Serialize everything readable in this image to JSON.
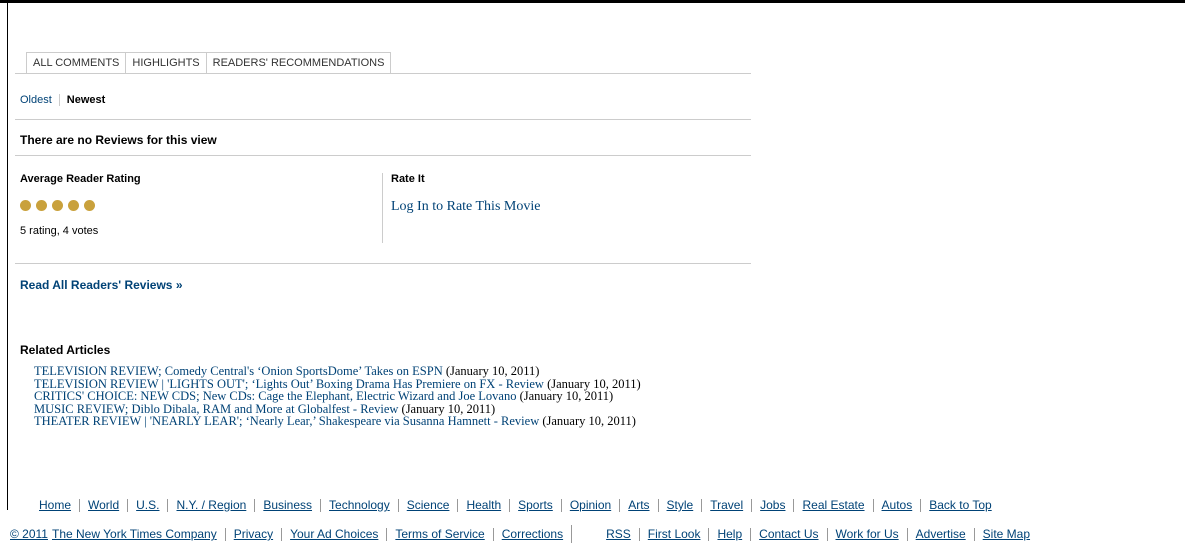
{
  "tabs": [
    "ALL COMMENTS",
    "HIGHLIGHTS",
    "READERS' RECOMMENDATIONS"
  ],
  "sort": {
    "oldest": "Oldest",
    "newest": "Newest"
  },
  "no_reviews": "There are no Reviews for this view",
  "rating": {
    "avg_title": "Average Reader Rating",
    "stars": 5,
    "summary": "5 rating, 4 votes",
    "color": "#c9a13c"
  },
  "rate_it": {
    "title": "Rate It",
    "link": "Log In to Rate This Movie"
  },
  "read_all": "Read All Readers' Reviews »",
  "related": {
    "title": "Related Articles",
    "items": [
      {
        "headline": "TELEVISION REVIEW; Comedy Central's ‘Onion SportsDome’ Takes on ESPN",
        "date": " (January 10, 2011)"
      },
      {
        "headline": "TELEVISION REVIEW | 'LIGHTS OUT'; ‘Lights Out’ Boxing Drama Has Premiere on FX - Review",
        "date": " (January 10, 2011)"
      },
      {
        "headline": "CRITICS' CHOICE: NEW CDS; New CDs: Cage the Elephant, Electric Wizard and Joe Lovano",
        "date": " (January 10, 2011)"
      },
      {
        "headline": "MUSIC REVIEW; Diblo Dibala, RAM and More at Globalfest - Review",
        "date": " (January 10, 2011)"
      },
      {
        "headline": "THEATER REVIEW | 'NEARLY LEAR'; ‘Nearly Lear,’ Shakespeare via Susanna Hamnett - Review",
        "date": " (January 10, 2011)"
      }
    ]
  },
  "footer_nav": [
    "Home",
    "World",
    "U.S.",
    "N.Y. / Region",
    "Business",
    "Technology",
    "Science",
    "Health",
    "Sports",
    "Opinion",
    "Arts",
    "Style",
    "Travel",
    "Jobs",
    "Real Estate",
    "Autos",
    "Back to Top"
  ],
  "footer_legal": {
    "copyright": "© 2011",
    "company": "The New York Times Company",
    "left_links": [
      "Privacy",
      "Your Ad Choices",
      "Terms of Service",
      "Corrections"
    ],
    "right_links": [
      "RSS",
      "First Look",
      "Help",
      "Contact Us",
      "Work for Us",
      "Advertise",
      "Site Map"
    ]
  },
  "colors": {
    "link": "#004276",
    "rule": "#cccccc"
  }
}
